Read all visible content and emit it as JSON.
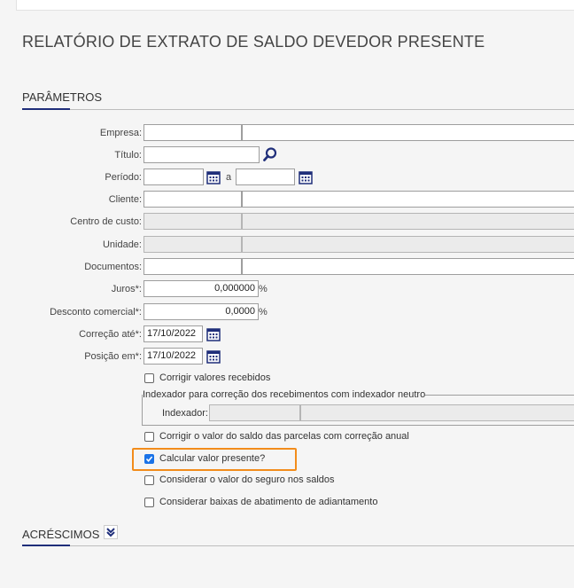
{
  "page": {
    "title": "RELATÓRIO DE EXTRATO DE SALDO DEVEDOR PRESENTE"
  },
  "sections": {
    "parametros": "PARÂMETROS",
    "acrescimos": "ACRÉSCIMOS"
  },
  "form": {
    "empresa_label": "Empresa:",
    "titulo_label": "Título:",
    "periodo_label": "Período:",
    "periodo_sep": "a",
    "cliente_label": "Cliente:",
    "centro_custo_label": "Centro de custo:",
    "unidade_label": "Unidade:",
    "documentos_label": "Documentos:",
    "juros_label": "Juros*:",
    "juros_value": "0,000000",
    "juros_unit": "%",
    "desconto_label": "Desconto comercial*:",
    "desconto_value": "0,0000",
    "desconto_unit": "%",
    "correcao_label": "Correção até*:",
    "correcao_value": "17/10/2022",
    "posicao_label": "Posição em*:",
    "posicao_value": "17/10/2022"
  },
  "options": {
    "corrigir_recebidos": "Corrigir valores recebidos",
    "indexador_legend": "Indexador para correção dos recebimentos com indexador neutro",
    "indexador_label": "Indexador:",
    "corrigir_saldo": "Corrigir o valor do saldo das parcelas com correção anual",
    "calcular_presente": "Calcular valor presente?",
    "considerar_seguro": "Considerar o valor do seguro nos saldos",
    "considerar_baixas": "Considerar baixas de abatimento de adiantamento"
  },
  "colors": {
    "accent": "#1f2e7a",
    "highlight": "#f28c1b",
    "checkbox": "#1a73e8"
  }
}
